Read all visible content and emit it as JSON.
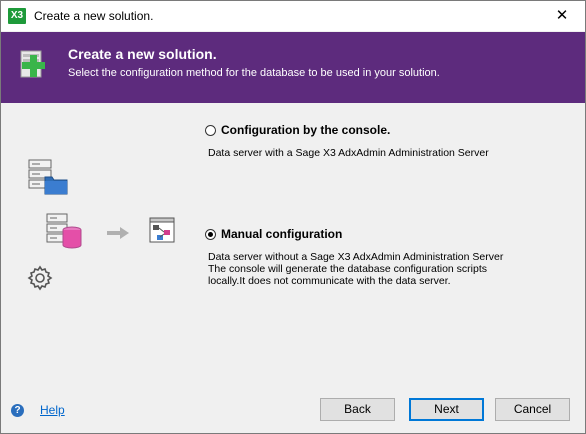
{
  "window": {
    "title": "Create a new solution.",
    "app_icon_text": "X3",
    "close_glyph": "✕"
  },
  "banner": {
    "title": "Create a new solution.",
    "subtitle": "Select the configuration method for the database to be used in your solution.",
    "color": "#5d2b7d"
  },
  "options": [
    {
      "label": "Configuration by the console.",
      "selected": false,
      "description": [
        "Data server with a Sage X3 AdxAdmin Administration Server"
      ]
    },
    {
      "label": "Manual configuration",
      "selected": true,
      "description": [
        "Data server without a Sage X3 AdxAdmin Administration Server",
        "The console will generate the database configuration scripts",
        "locally.It does not communicate with the data server."
      ]
    }
  ],
  "footer": {
    "help_label": "Help",
    "back_label": "Back",
    "next_label": "Next",
    "cancel_label": "Cancel"
  }
}
